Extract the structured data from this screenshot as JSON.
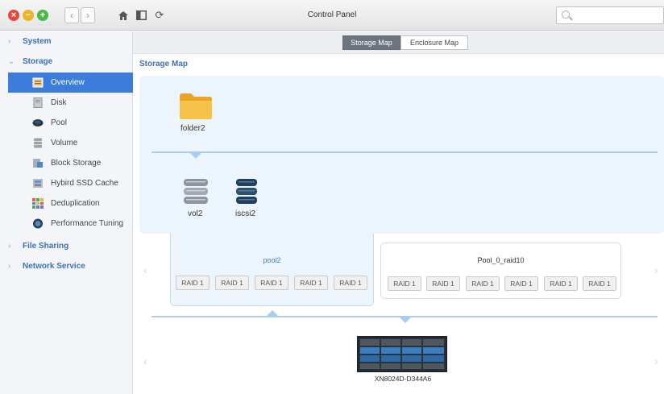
{
  "window": {
    "title": "Control Panel",
    "search_placeholder": ""
  },
  "sidebar": {
    "categories": [
      {
        "label": "System",
        "chevron": "›"
      },
      {
        "label": "Storage",
        "chevron": "⌄"
      },
      {
        "label": "File Sharing",
        "chevron": "›"
      },
      {
        "label": "Network Service",
        "chevron": "›"
      }
    ],
    "items": [
      {
        "label": "Overview",
        "icon": "overview-icon"
      },
      {
        "label": "Disk",
        "icon": "disk-icon"
      },
      {
        "label": "Pool",
        "icon": "pool-icon"
      },
      {
        "label": "Volume",
        "icon": "volume-icon"
      },
      {
        "label": "Block Storage",
        "icon": "block-storage-icon"
      },
      {
        "label": "Hybird SSD Cache",
        "icon": "ssd-cache-icon"
      },
      {
        "label": "Deduplication",
        "icon": "deduplication-icon"
      },
      {
        "label": "Performance Tuning",
        "icon": "performance-tuning-icon"
      }
    ],
    "active_index": 0
  },
  "tabs": [
    {
      "label": "Storage Map",
      "active": true
    },
    {
      "label": "Enclosure Map",
      "active": false
    }
  ],
  "main": {
    "title": "Storage Map",
    "folder": {
      "label": "folder2"
    },
    "volumes": [
      {
        "label": "vol2",
        "color": "#8e959e"
      },
      {
        "label": "iscsi2",
        "color": "#1f3f5a"
      }
    ],
    "pools": [
      {
        "name": "pool2",
        "raids": [
          "RAID 1",
          "RAID 1",
          "RAID 1",
          "RAID 1",
          "RAID 1"
        ],
        "selected": true
      },
      {
        "name": "Pool_0_raid10",
        "raids": [
          "RAID 1",
          "RAID 1",
          "RAID 1",
          "RAID 1",
          "RAID 1",
          "RAID 1"
        ],
        "selected": false
      }
    ],
    "enclosure": {
      "label": "XN8024D-D344A6"
    }
  },
  "colors": {
    "accent": "#3c7ddb",
    "link": "#3d6fb8",
    "connector": "#a9cdef",
    "panel": "#edf5fc"
  }
}
